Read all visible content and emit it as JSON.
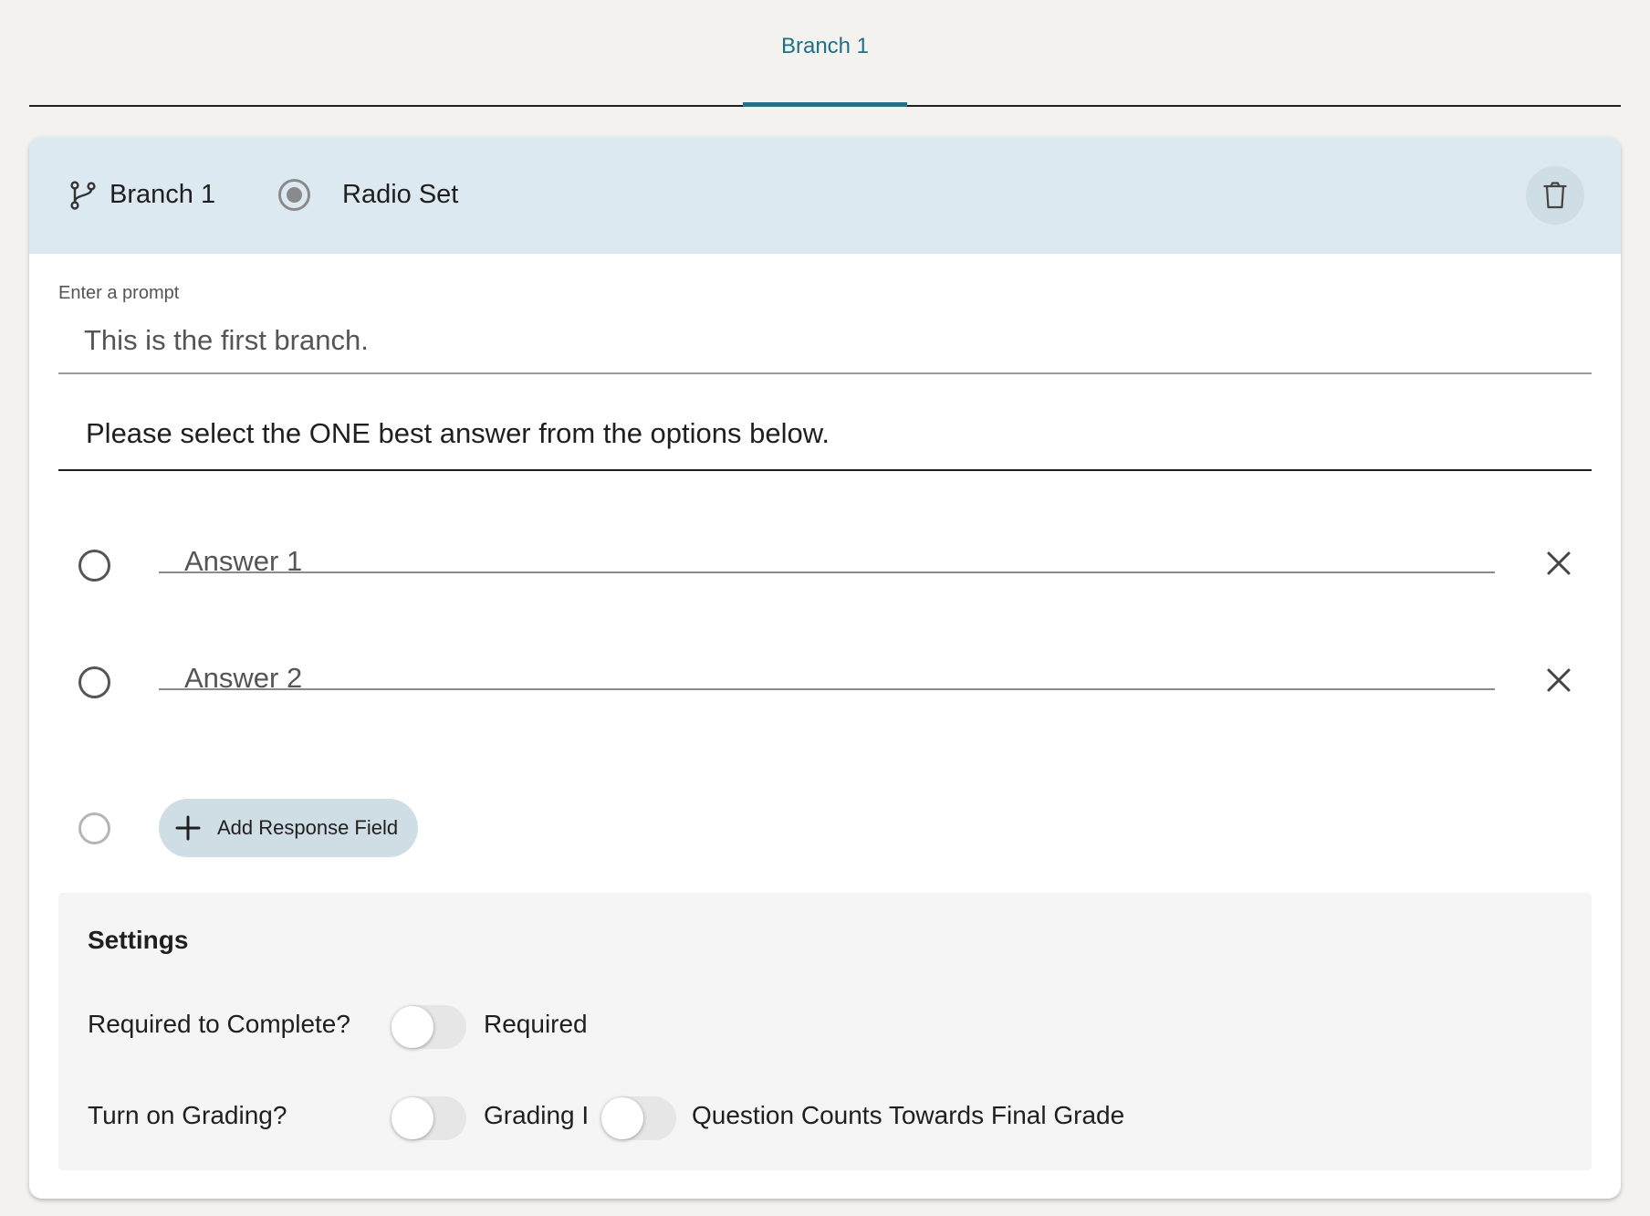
{
  "tabs": [
    {
      "label": "Branch 1",
      "active": true
    }
  ],
  "header": {
    "branch_label": "Branch 1",
    "type_label": "Radio Set",
    "icons": {
      "branch": "branch-icon",
      "type": "radio-set-icon",
      "delete": "trash-icon"
    }
  },
  "prompt": {
    "label": "Enter a prompt",
    "value": "This is the first branch."
  },
  "instruction": {
    "value": "Please select the ONE best answer from the options below."
  },
  "answers": [
    {
      "label": "Answer 1"
    },
    {
      "label": "Answer 2"
    }
  ],
  "add_response": {
    "label": "Add Response Field"
  },
  "settings": {
    "title": "Settings",
    "required": {
      "question": "Required to Complete?",
      "toggle_label": "Required",
      "on": false
    },
    "grading": {
      "question": "Turn on Grading?",
      "toggle_label": "Grading I",
      "on": false,
      "final_grade_label": "Question Counts Towards Final Grade",
      "final_grade_on": false
    }
  },
  "colors": {
    "accent": "#2a6f86",
    "header_bg": "#dde9f0",
    "button_bg": "#cfdde5",
    "page_bg": "#f3f2ef"
  }
}
